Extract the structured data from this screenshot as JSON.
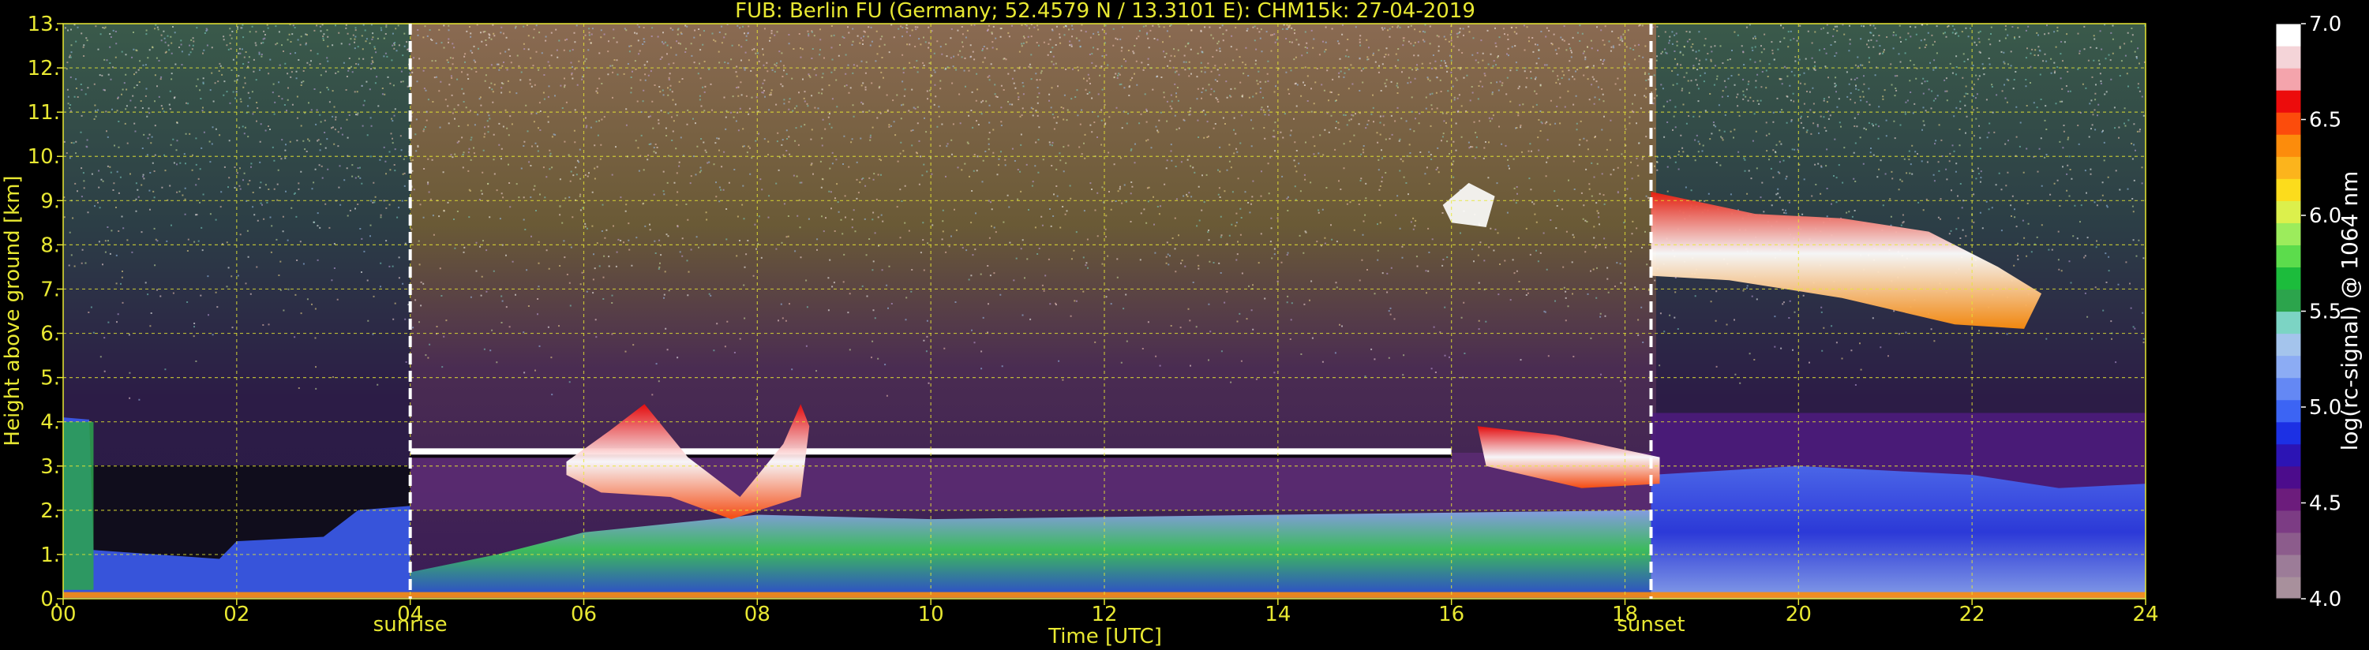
{
  "chart_data": {
    "type": "heatmap",
    "title": "FUB: Berlin FU (Germany; 52.4579 N / 13.3101 E):    CHM15k: 27-04-2019",
    "xlabel": "Time [UTC]",
    "ylabel": "Height above ground [km]",
    "xlim": [
      0,
      24
    ],
    "ylim": [
      0,
      13
    ],
    "x_ticks": [
      "00",
      "02",
      "04",
      "06",
      "08",
      "10",
      "12",
      "14",
      "16",
      "18",
      "20",
      "22",
      "24"
    ],
    "x_tick_values": [
      0,
      2,
      4,
      6,
      8,
      10,
      12,
      14,
      16,
      18,
      20,
      22,
      24
    ],
    "y_ticks": [
      "0.",
      "1.",
      "2.",
      "3.",
      "4.",
      "5.",
      "6.",
      "7.",
      "8.",
      "9.",
      "10.",
      "11.",
      "12.",
      "13."
    ],
    "y_tick_values": [
      0,
      1,
      2,
      3,
      4,
      5,
      6,
      7,
      8,
      9,
      10,
      11,
      12,
      13
    ],
    "grid": true,
    "markers": [
      {
        "label": "sunrise",
        "x": 4.0
      },
      {
        "label": "sunset",
        "x": 18.3
      }
    ],
    "colorbar": {
      "label": "log(rc-signal) @ 1064 nm",
      "range": [
        4.0,
        7.0
      ],
      "ticks": [
        "4.0",
        "4.5",
        "5.0",
        "5.5",
        "6.0",
        "6.5",
        "7.0"
      ],
      "tick_values": [
        4.0,
        4.5,
        5.0,
        5.5,
        6.0,
        6.5,
        7.0
      ],
      "colors": [
        "#a8909c",
        "#9c7c98",
        "#8c5c8c",
        "#7c3c84",
        "#6c1c7c",
        "#4c0c8c",
        "#2c14b4",
        "#1c30e4",
        "#3c64f4",
        "#6488f4",
        "#8cacf4",
        "#a4c4ec",
        "#7cd4c4",
        "#2ca44c",
        "#1cbc3c",
        "#5cdc4c",
        "#9cec5c",
        "#dcf04c",
        "#fcdc1c",
        "#fcb41c",
        "#fc8c0c",
        "#fc4c0c",
        "#ec0c0c",
        "#f4a4ac",
        "#f4d4d8",
        "#ffffff"
      ]
    },
    "features": [
      {
        "type": "boundary layer",
        "time_range": [
          0,
          24
        ],
        "height_range_km": [
          0,
          2.0
        ],
        "level": "5.0-5.8"
      },
      {
        "type": "aerosol layer top",
        "time_range": [
          4.0,
          16.0
        ],
        "height_km": 3.3,
        "level": "6.5-7.0"
      },
      {
        "type": "cloud",
        "time_range": [
          5.8,
          8.6
        ],
        "height_range_km": [
          1.8,
          4.4
        ],
        "level": "6.0-7.0"
      },
      {
        "type": "cloud",
        "time_range": [
          16.3,
          18.4
        ],
        "height_range_km": [
          2.5,
          3.9
        ],
        "level": "6.2-7.0"
      },
      {
        "type": "cirrus",
        "time_range": [
          18.3,
          22.8
        ],
        "height_range_km": [
          6.0,
          9.2
        ],
        "level": "6.0-7.0"
      },
      {
        "type": "cirrus",
        "time_range": [
          15.9,
          16.5
        ],
        "height_range_km": [
          8.4,
          9.4
        ],
        "level": "6.5-7.0"
      }
    ]
  }
}
